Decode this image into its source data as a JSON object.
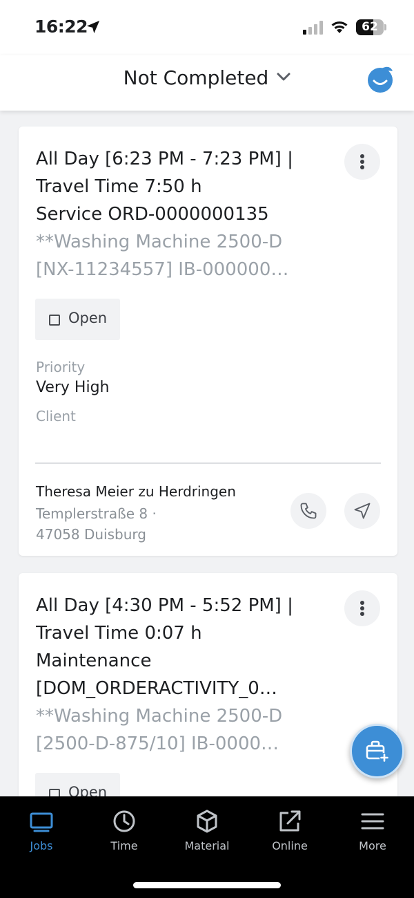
{
  "status_bar": {
    "time": "16:22",
    "battery": "62"
  },
  "header": {
    "title": "Not Completed"
  },
  "jobs": [
    {
      "title_lines": [
        "All Day [6:23 PM - 7:23 PM] |",
        "Travel Time 7:50 h",
        "Service ORD-0000000135"
      ],
      "description_lines": [
        "**Washing Machine 2500-D",
        "[NX-11234557] IB-000000…"
      ],
      "status": "Open",
      "priority_label": "Priority",
      "priority_value": "Very High",
      "client_label": "Client",
      "contact_name": "Theresa Meier zu Herdringen",
      "address_line1": "Templerstraße 8 ·",
      "address_line2": "47058 Duisburg"
    },
    {
      "title_lines": [
        "All Day [4:30 PM - 5:52 PM] |",
        "Travel Time 0:07 h",
        "Maintenance",
        "[DOM_ORDERACTIVITY_0…"
      ],
      "description_lines": [
        "**Washing Machine 2500-D",
        "[2500-D-875/10] IB-0000…"
      ],
      "status": "Open"
    }
  ],
  "tabs": [
    {
      "label": "Jobs",
      "icon": "jobs-icon",
      "active": true
    },
    {
      "label": "Time",
      "icon": "clock-icon"
    },
    {
      "label": "Material",
      "icon": "cube-icon"
    },
    {
      "label": "Online",
      "icon": "external-link-icon"
    },
    {
      "label": "More",
      "icon": "hamburger-menu-icon"
    }
  ],
  "colors": {
    "accent": "#3d8ed6",
    "muted_text": "#9aa1a8",
    "chip_bg": "#f1f2f4"
  }
}
